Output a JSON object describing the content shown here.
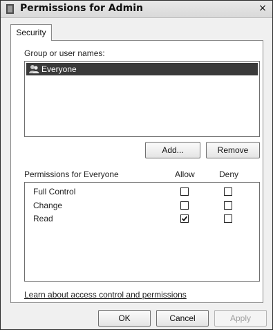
{
  "window": {
    "title": "Permissions for Admin",
    "close_glyph": "×"
  },
  "tabs": [
    {
      "label": "Security",
      "selected": true
    }
  ],
  "group_section": {
    "label": "Group or user names:",
    "items": [
      {
        "name": "Everyone",
        "icon": "users-icon",
        "selected": true
      }
    ],
    "add_button": "Add...",
    "remove_button": "Remove"
  },
  "permissions": {
    "header": "Permissions for Everyone",
    "allow_header": "Allow",
    "deny_header": "Deny",
    "rows": [
      {
        "name": "Full Control",
        "allow": false,
        "deny": false
      },
      {
        "name": "Change",
        "allow": false,
        "deny": false
      },
      {
        "name": "Read",
        "allow": true,
        "deny": false
      }
    ]
  },
  "link": "Learn about access control and permissions",
  "footer": {
    "ok": "OK",
    "cancel": "Cancel",
    "apply": "Apply",
    "apply_enabled": false
  }
}
